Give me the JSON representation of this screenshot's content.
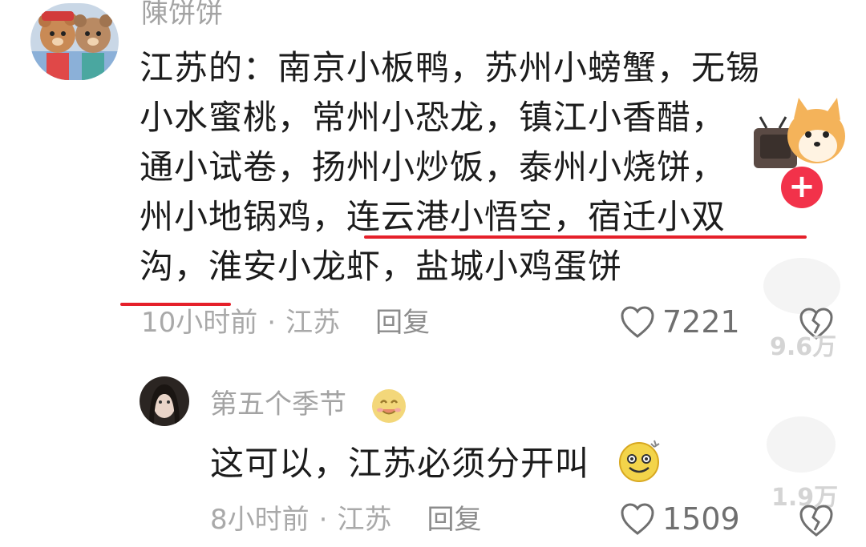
{
  "comment1": {
    "username": "陳饼饼",
    "lines": [
      "江苏的：南京小板鸭，苏州小螃蟹，无锡",
      "小水蜜桃，常州小恐龙，镇江小香醋，",
      "通小试卷，扬州小炒饭，泰州小烧饼，",
      "州小地锅鸡，连云港小悟空，宿迁小双",
      "沟，淮安小龙虾，盐城小鸡蛋饼"
    ],
    "time": "10小时前",
    "dot": "·",
    "location": "江苏",
    "reply": "回复",
    "likes": "7221",
    "side_count": "9.6万"
  },
  "comment2": {
    "username": "第五个季节",
    "text": "这可以，江苏必须分开叫",
    "time": "8小时前",
    "dot": "·",
    "location": "江苏",
    "reply": "回复",
    "likes": "1509",
    "side_count": "1.9万"
  },
  "colors": {
    "underline": "#e5202a",
    "plus_button": "#f2324a",
    "muted_text": "#a3a3a3"
  },
  "icons": [
    "heart-outline-icon",
    "broken-heart-icon",
    "plus-icon",
    "smile-emoji-icon",
    "dizzy-smile-emoji-icon"
  ],
  "plus_label": "+"
}
